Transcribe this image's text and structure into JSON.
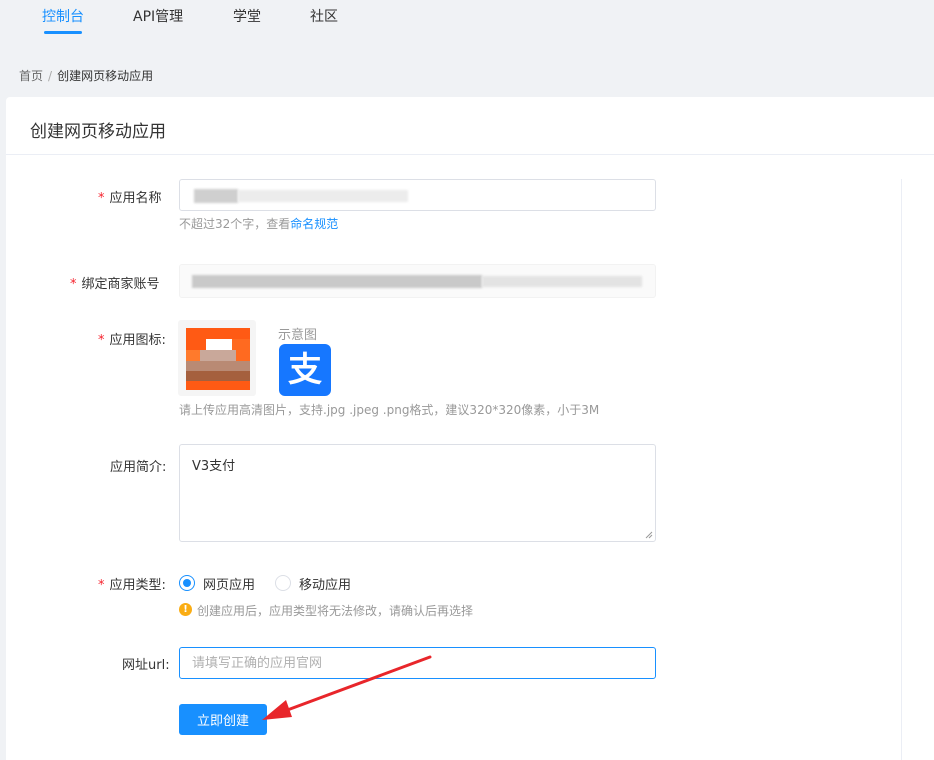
{
  "topnav": {
    "items": [
      {
        "label": "控制台",
        "active": true
      },
      {
        "label": "API管理",
        "active": false
      },
      {
        "label": "学堂",
        "active": false
      },
      {
        "label": "社区",
        "active": false
      }
    ]
  },
  "breadcrumb": {
    "home": "首页",
    "separator": "/",
    "current": "创建网页移动应用"
  },
  "card": {
    "title": "创建网页移动应用"
  },
  "form": {
    "app_name": {
      "label": "应用名称",
      "required_mark": "*",
      "hint_prefix": "不超过32个字，查看",
      "hint_link": "命名规范"
    },
    "merchant_account": {
      "label": "绑定商家账号",
      "required_mark": "*"
    },
    "app_icon": {
      "label": "应用图标:",
      "required_mark": "*",
      "sample_label": "示意图",
      "sample_glyph": "支",
      "hint": "请上传应用高清图片，支持.jpg .jpeg .png格式，建议320*320像素，小于3M"
    },
    "app_desc": {
      "label": "应用简介:",
      "value": "V3支付"
    },
    "app_type": {
      "label": "应用类型:",
      "required_mark": "*",
      "options": [
        {
          "label": "网页应用",
          "selected": true
        },
        {
          "label": "移动应用",
          "selected": false
        }
      ],
      "warning_glyph": "!",
      "warning": "创建应用后，应用类型将无法修改，请确认后再选择"
    },
    "url": {
      "label": "网址url:",
      "placeholder": "请填写正确的应用官网",
      "value": ""
    },
    "submit_label": "立即创建"
  },
  "colors": {
    "primary": "#1890ff",
    "required": "#f5222d",
    "warning": "#faad14",
    "annotation_arrow": "#e8262b",
    "alipay_blue": "#1677ff"
  }
}
